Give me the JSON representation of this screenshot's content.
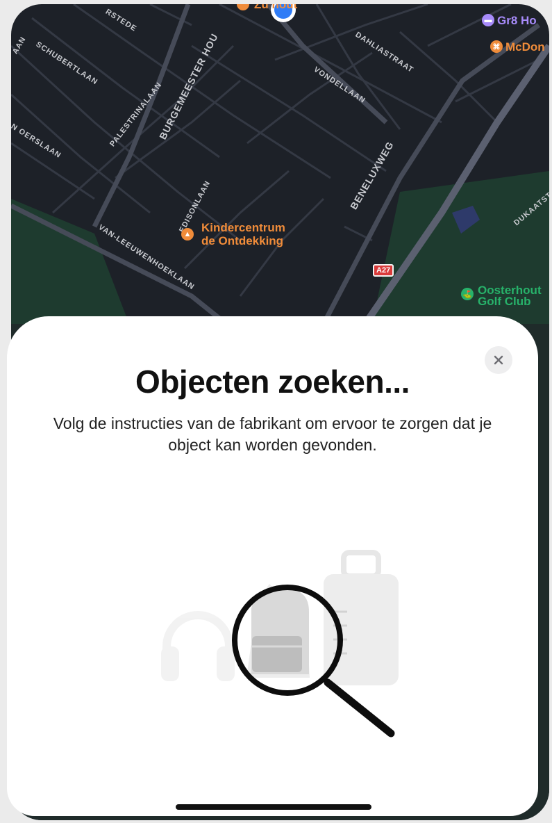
{
  "map": {
    "streets": [
      {
        "id": "oerslaan",
        "label": "N OERSLAAN"
      },
      {
        "id": "schubertlaan",
        "label": "SCHUBERTLAAN"
      },
      {
        "id": "palestrinalaan",
        "label": "PALESTRINALAAN"
      },
      {
        "id": "burgemeester",
        "label": "BURGEMEESTER HOU"
      },
      {
        "id": "rstede",
        "label": "RSTEDE"
      },
      {
        "id": "dahliastraat",
        "label": "DAHLIASTRAAT"
      },
      {
        "id": "vondellaan",
        "label": "VONDELLAAN"
      },
      {
        "id": "beneluxweg",
        "label": "BENELUXWEG"
      },
      {
        "id": "edisonlaan",
        "label": "EDISONLAAN"
      },
      {
        "id": "leeuwenhoeklaan",
        "label": "VAN-LEEUWENHOEKLAAN"
      },
      {
        "id": "dukaatstraat",
        "label": "DUKAATST"
      },
      {
        "id": "aan",
        "label": "AAN"
      }
    ],
    "pois": {
      "top_partial": "Zu      hout",
      "hotel": "Gr8 Ho",
      "mcdonalds": "McDon",
      "kindercentrum_line1": "Kindercentrum",
      "kindercentrum_line2": "de Ontdekking",
      "golf_line1": "Oosterhout",
      "golf_line2": "Golf Club"
    },
    "road_badge": "A27",
    "colors": {
      "background": "#1d2128",
      "road": "#343944",
      "park": "#1e3b2f",
      "poi_orange": "#f08c3a",
      "poi_green": "#27b26a",
      "poi_purple": "#a78bfa",
      "location_dot": "#2f7cf6"
    }
  },
  "sheet": {
    "title": "Objecten zoeken...",
    "subtitle": "Volg de instructies van de fabrikant om ervoor te zorgen dat je object kan worden gevonden.",
    "close_icon": "close-icon",
    "illustration_icons": [
      "headphones-icon",
      "backpack-icon",
      "suitcase-icon",
      "magnifying-glass-icon"
    ]
  }
}
